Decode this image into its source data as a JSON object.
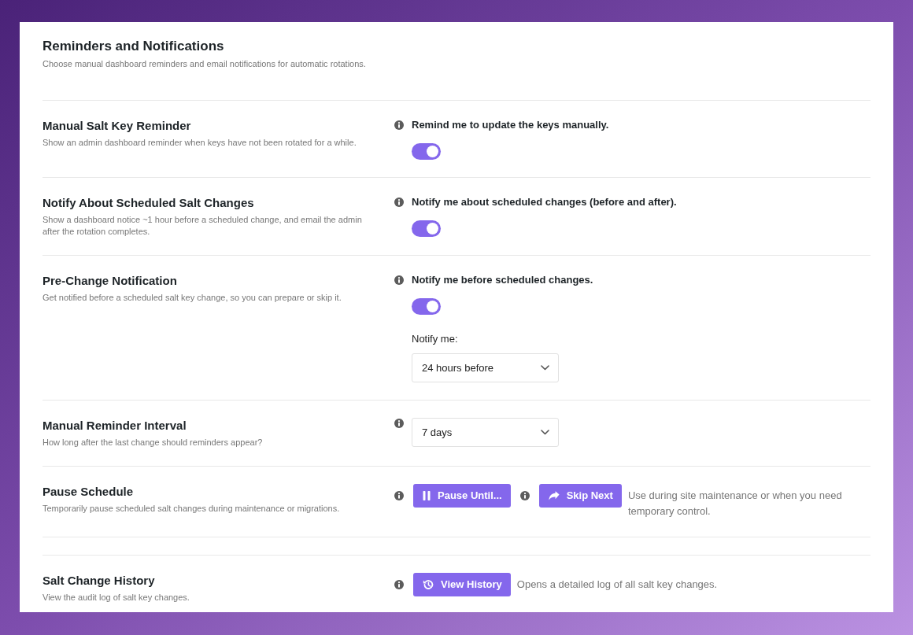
{
  "header": {
    "title": "Reminders and Notifications",
    "description": "Choose manual dashboard reminders and email notifications for automatic rotations."
  },
  "sections": [
    {
      "rows": [
        {
          "kind": "toggle",
          "title": "Manual Salt Key Reminder",
          "description": "Show an admin dashboard reminder when keys have not been rotated for a while.",
          "label": "Remind me to update the keys manually.",
          "on": true
        },
        {
          "kind": "toggle",
          "title": "Notify About Scheduled Salt Changes",
          "description": "Show a dashboard notice ~1 hour before a scheduled change, and email the admin after the rotation completes.",
          "label": "Notify me about scheduled changes (before and after).",
          "on": true
        },
        {
          "kind": "toggle",
          "title": "Pre-Change Notification",
          "description": "Get notified before a scheduled salt key change, so you can prepare or skip it.",
          "label": "Notify me before scheduled changes.",
          "on": true,
          "select": {
            "label": "Notify me:",
            "value": "24 hours before"
          }
        },
        {
          "kind": "select",
          "title": "Manual Reminder Interval",
          "description": "How long after the last change should reminders appear?",
          "value": "7 days"
        },
        {
          "kind": "actions",
          "title": "Pause Schedule",
          "description": "Temporarily pause scheduled salt changes during maintenance or migrations.",
          "buttons": [
            {
              "kind": "pause",
              "label": "Pause Until..."
            },
            {
              "kind": "skip",
              "label": "Skip Next"
            }
          ],
          "note": "Use during site maintenance or when you need temporary control."
        }
      ]
    },
    {
      "rows": [
        {
          "kind": "actions",
          "title": "Salt Change History",
          "description": "View the audit log of salt key changes.",
          "buttons": [
            {
              "kind": "history",
              "label": "View History"
            }
          ],
          "note": "Opens a detailed log of all salt key changes."
        }
      ]
    }
  ]
}
